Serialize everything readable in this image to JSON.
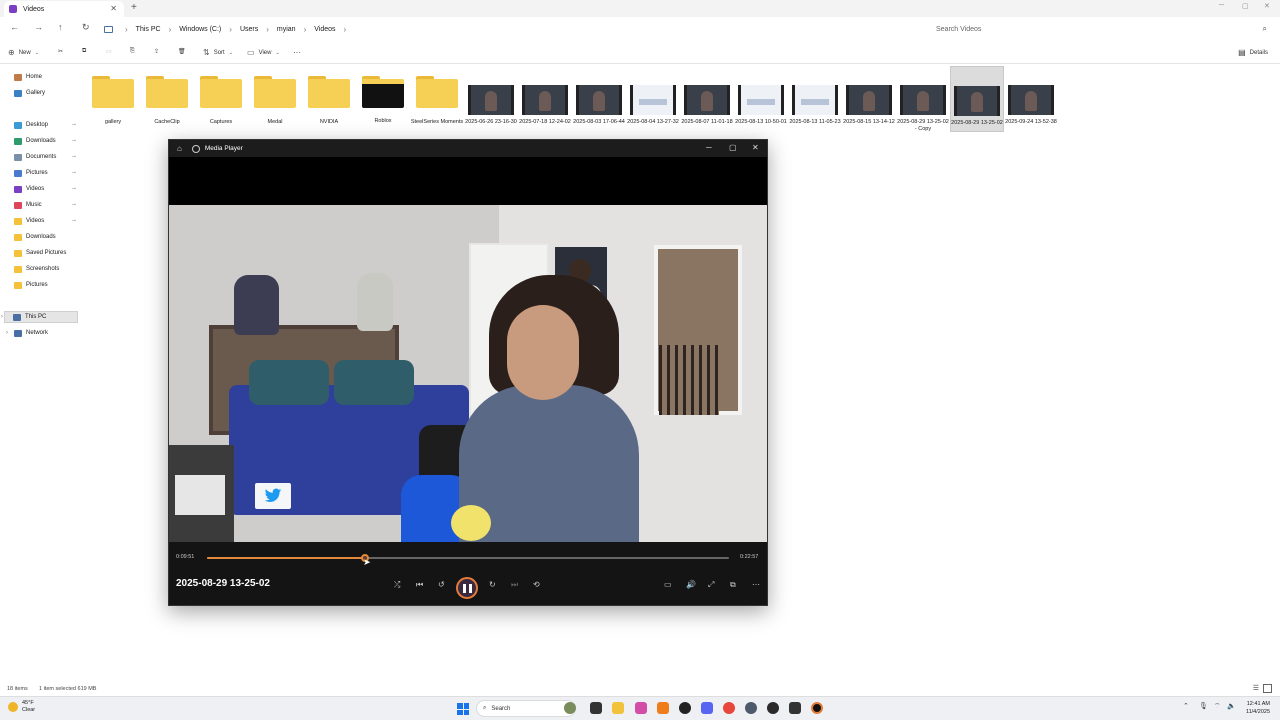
{
  "window": {
    "tab_title": "Videos",
    "new_tab_glyph": "+",
    "close_glyph": "✕"
  },
  "address": {
    "crumbs": [
      "This PC",
      "Windows (C:)",
      "Users",
      "myian",
      "Videos"
    ],
    "search_placeholder": "Search Videos"
  },
  "toolbar": {
    "new_label": "New",
    "sort_label": "Sort",
    "view_label": "View",
    "more_glyph": "···",
    "details_label": "Details"
  },
  "sidebar": {
    "items": [
      {
        "label": "Home",
        "icon": "home-icon",
        "pinned": false
      },
      {
        "label": "Gallery",
        "icon": "gallery-icon",
        "pinned": false
      },
      {
        "label": "Desktop",
        "icon": "desktop-icon",
        "pinned": true
      },
      {
        "label": "Downloads",
        "icon": "download-icon",
        "pinned": true
      },
      {
        "label": "Documents",
        "icon": "document-icon",
        "pinned": true
      },
      {
        "label": "Pictures",
        "icon": "pictures-icon",
        "pinned": true
      },
      {
        "label": "Videos",
        "icon": "videos-icon",
        "pinned": true
      },
      {
        "label": "Music",
        "icon": "music-icon",
        "pinned": true
      },
      {
        "label": "Videos",
        "icon": "folder-icon",
        "pinned": true
      },
      {
        "label": "Downloads",
        "icon": "folder-icon",
        "pinned": false
      },
      {
        "label": "Saved Pictures",
        "icon": "folder-icon",
        "pinned": false
      },
      {
        "label": "Screenshots",
        "icon": "folder-icon",
        "pinned": false
      },
      {
        "label": "Pictures",
        "icon": "folder-icon",
        "pinned": false
      },
      {
        "label": "This PC",
        "icon": "pc-icon",
        "pinned": false
      },
      {
        "label": "Network",
        "icon": "network-icon",
        "pinned": false
      }
    ],
    "pin_glyph": "📌"
  },
  "files": [
    {
      "name": "gallery",
      "kind": "folder"
    },
    {
      "name": "CacheClip",
      "kind": "folder"
    },
    {
      "name": "Captures",
      "kind": "folder"
    },
    {
      "name": "Medal",
      "kind": "folder"
    },
    {
      "name": "NVIDIA",
      "kind": "folder"
    },
    {
      "name": "Roblox",
      "kind": "folder-dark"
    },
    {
      "name": "SteelSeries Moments",
      "kind": "folder"
    },
    {
      "name": "2025-06-26 23-16-30",
      "kind": "video"
    },
    {
      "name": "2025-07-18 12-24-02",
      "kind": "video"
    },
    {
      "name": "2025-08-03 17-06-44",
      "kind": "video"
    },
    {
      "name": "2025-08-04 13-27-32",
      "kind": "video-light"
    },
    {
      "name": "2025-08-07 11-01-18",
      "kind": "video"
    },
    {
      "name": "2025-08-13 10-50-01",
      "kind": "video-light"
    },
    {
      "name": "2025-08-13 11-05-23",
      "kind": "video-light"
    },
    {
      "name": "2025-08-15 13-14-12",
      "kind": "video"
    },
    {
      "name": "2025-08-29 13-25-02 - Copy",
      "kind": "video"
    },
    {
      "name": "2025-08-29 13-25-02",
      "kind": "video",
      "selected": true
    },
    {
      "name": "2025-09-24 13-52-38",
      "kind": "video"
    }
  ],
  "player": {
    "app_name": "Media Player",
    "current_time": "0:09:51",
    "duration": "0:22:57",
    "progress": 0.303,
    "video_title": "2025-08-29 13-25-02",
    "accent_color": "#e58a3a"
  },
  "status": {
    "items_count": "18 items",
    "selection": "1 item selected  619 MB"
  },
  "taskbar": {
    "temperature": "45°F",
    "condition": "Clear",
    "search_label": "Search",
    "time": "12:41 AM",
    "date": "11/4/2025"
  }
}
